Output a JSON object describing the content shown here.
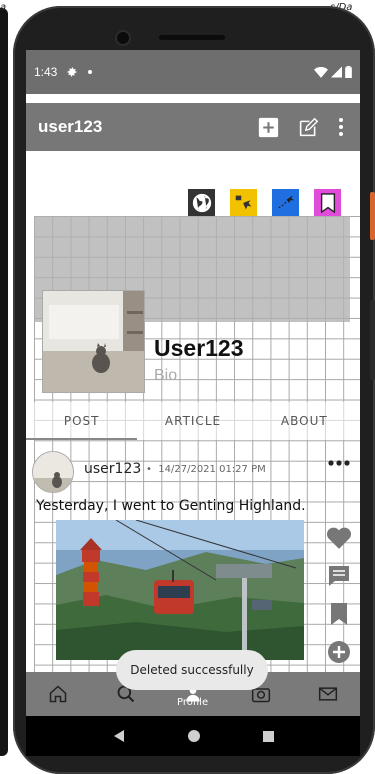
{
  "status": {
    "time": "1:43"
  },
  "appbar": {
    "title": "user123"
  },
  "profile": {
    "name": "User123",
    "bio": "Bio"
  },
  "tabs": [
    {
      "label": "POST"
    },
    {
      "label": "ARTICLE"
    },
    {
      "label": "ABOUT"
    }
  ],
  "post": {
    "username": "user123",
    "separator": "•",
    "timestamp": "14/27/2021 01:27 PM",
    "text": "Yesterday, I went to Genting Highland."
  },
  "bottom_nav": {
    "active_label": "Profile"
  },
  "toast": {
    "message": "Deleted successfully"
  },
  "peek": {
    "left": "a",
    "right": "s/Da"
  },
  "icons": {
    "corner": [
      "globe-icon",
      "plane-map-icon",
      "flight-route-icon",
      "bookmark-icon"
    ],
    "corner_colors": [
      "#333333",
      "#f2c200",
      "#1f6fe0",
      "#e04bd9"
    ]
  }
}
